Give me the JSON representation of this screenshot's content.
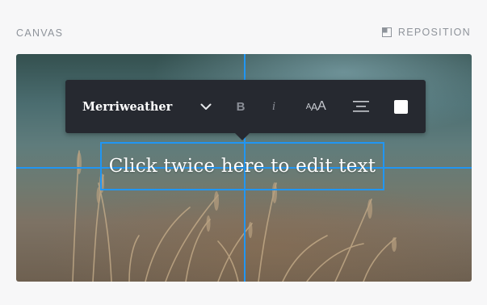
{
  "header": {
    "title": "CANVAS",
    "reposition_label": "REPOSITION"
  },
  "canvas": {
    "text": "Click twice here to edit text",
    "guide_color": "#2196f3"
  },
  "toolbar": {
    "font_name": "Merriweather",
    "bold_label": "B",
    "italic_label": "i",
    "size_small": "A",
    "size_medium": "A",
    "size_large": "A",
    "text_color": "#ffffff",
    "icons": [
      "chevron-down-icon",
      "align-center-icon",
      "color-swatch"
    ]
  }
}
